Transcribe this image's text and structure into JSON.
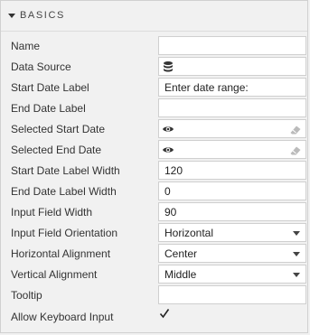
{
  "section": {
    "title": "BASICS",
    "caret_icon": "caret-down-icon"
  },
  "rows": [
    {
      "label": "Name",
      "value": ""
    },
    {
      "label": "Data Source",
      "icon": "database-icon"
    },
    {
      "label": "Start Date Label",
      "value": "Enter date range:"
    },
    {
      "label": "End Date Label",
      "value": ""
    },
    {
      "label": "Selected Start Date",
      "icon": "eye-icon",
      "trailing_icon": "eraser-icon"
    },
    {
      "label": "Selected End Date",
      "icon": "eye-icon",
      "trailing_icon": "eraser-icon"
    },
    {
      "label": "Start Date Label Width",
      "value": "120"
    },
    {
      "label": "End Date Label Width",
      "value": "0"
    },
    {
      "label": "Input Field Width",
      "value": "90"
    },
    {
      "label": "Input Field Orientation",
      "value": "Horizontal",
      "dropdown": true
    },
    {
      "label": "Horizontal Alignment",
      "value": "Center",
      "dropdown": true
    },
    {
      "label": "Vertical Alignment",
      "value": "Middle",
      "dropdown": true
    },
    {
      "label": "Tooltip",
      "value": ""
    },
    {
      "label": "Allow Keyboard Input",
      "checked": true,
      "icon": "checkmark-icon"
    }
  ]
}
